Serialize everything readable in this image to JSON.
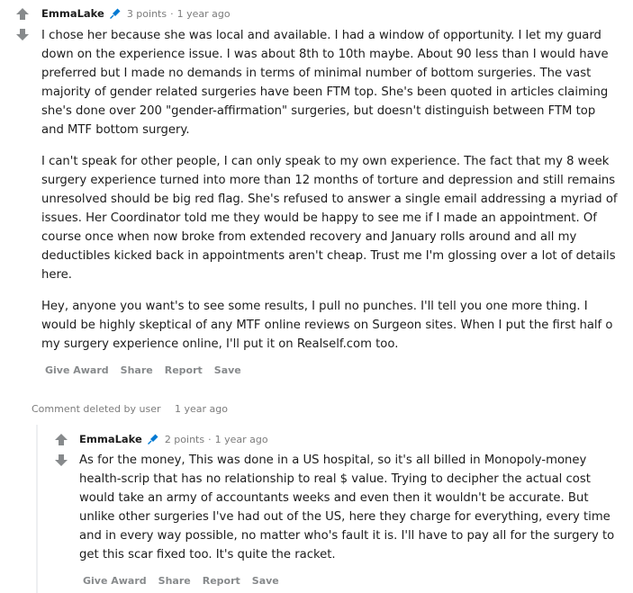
{
  "comment1": {
    "author": "EmmaLake",
    "points": "3 points",
    "separator": "·",
    "time": "1 year ago",
    "paragraphs": [
      "I chose her because she was local and available. I had a window of opportunity. I let my guard down on the experience issue. I was about 8th to 10th maybe. About 90 less than I would have preferred but I made no demands in terms of minimal number of bottom surgeries. The vast majority of gender related surgeries have been FTM top. She's been quoted in articles claiming she's done over 200 \"gender-affirmation\" surgeries, but doesn't distinguish between FTM top and MTF bottom surgery.",
      "I can't speak for other people, I can only speak to my own experience. The fact that my 8 week surgery experience turned into more than 12 months of torture and depression and still remains unresolved should be big red flag. She's refused to answer a single email addressing a myriad of issues. Her Coordinator told me they would be happy to see me if I made an appointment. Of course once when now broke from extended recovery and January rolls around and all my deductibles kicked back in appointments aren't cheap. Trust me I'm glossing over a lot of details here.",
      "Hey, anyone you want's to see some results, I pull no punches. I'll tell you one more thing. I would be highly skeptical of any MTF online reviews on Surgeon sites. When I put the first half o my surgery experience online, I'll put it on Realself.com too."
    ],
    "actions": {
      "give_award": "Give Award",
      "share": "Share",
      "report": "Report",
      "save": "Save"
    }
  },
  "deleted_comment": {
    "label": "Comment deleted by user",
    "time": "1 year ago"
  },
  "comment2": {
    "author": "EmmaLake",
    "points": "2 points",
    "separator": "·",
    "time": "1 year ago",
    "paragraphs": [
      "As for the money, This was done in a US hospital, so it's all billed in Monopoly-money health-scrip that has no relationship to real $ value. Trying to decipher the actual cost would take an army of accountants weeks and even then it wouldn't be accurate. But unlike other surgeries I've had out of the US, here they charge for everything, every time and in every way possible, no matter who's fault it is. I'll have to pay all for the surgery to get this scar fixed too. It's quite the racket."
    ],
    "actions": {
      "give_award": "Give Award",
      "share": "Share",
      "report": "Report",
      "save": "Save"
    }
  },
  "icons": {
    "upvote": "upvote-arrow-icon",
    "downvote": "downvote-arrow-icon",
    "flair": "microphone-flair-icon"
  },
  "colors": {
    "arrow": "#878a8c",
    "flair": "#0079d3",
    "text": "#1c1c1c",
    "meta": "#7c7c7c"
  }
}
